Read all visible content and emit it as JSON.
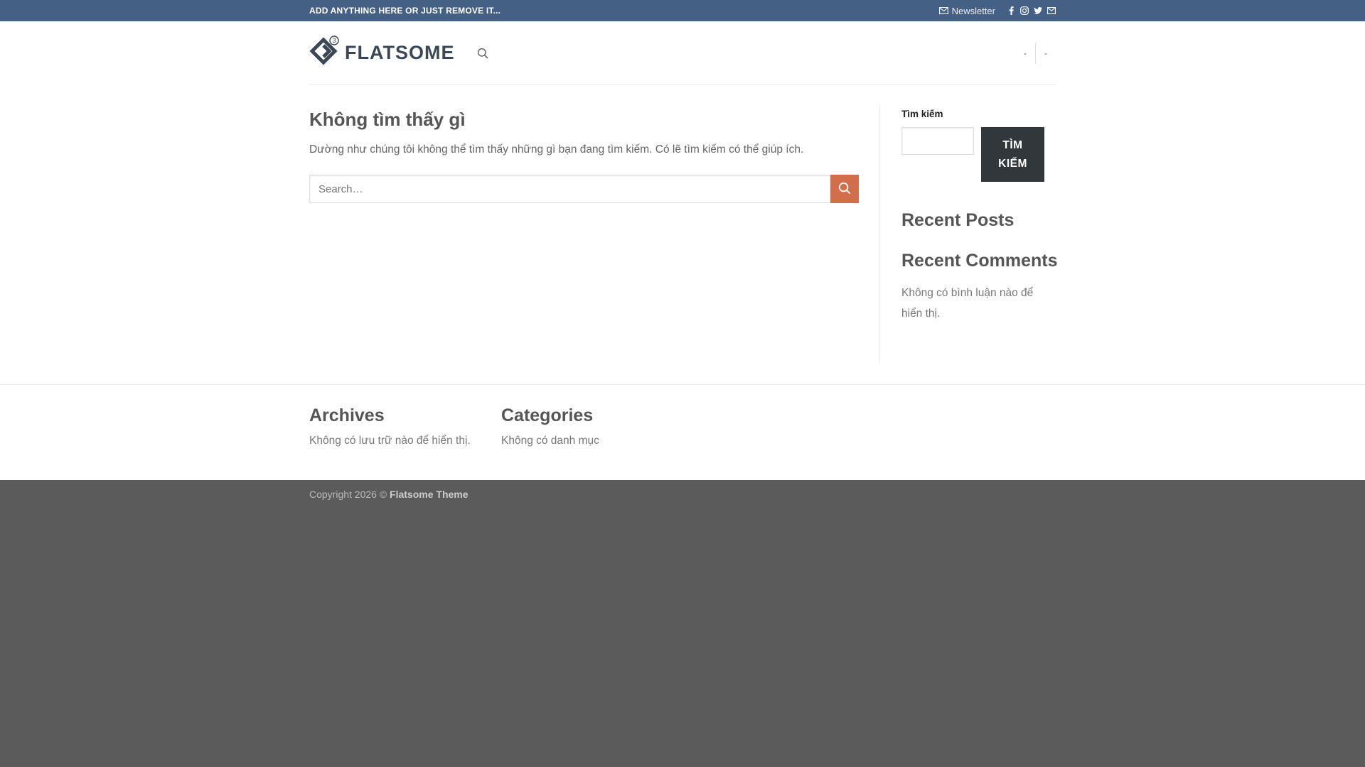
{
  "topbar": {
    "text": "ADD ANYTHING HERE OR JUST REMOVE IT...",
    "newsletter_label": "Newsletter",
    "social_icons": [
      "facebook-icon",
      "instagram-icon",
      "twitter-icon",
      "email-icon"
    ]
  },
  "header": {
    "logo_text": "FLATSOME",
    "logo_badge": "3",
    "right_links": [
      "-",
      "-"
    ]
  },
  "main": {
    "title": "Không tìm thấy gì",
    "description": "Dường như chúng tôi không thể tìm thấy những gì bạn đang tìm kiếm. Có lẽ tìm kiếm có thể giúp ích.",
    "search_placeholder": "Search…"
  },
  "sidebar": {
    "search_label": "Tìm kiếm",
    "search_button": "TÌM KIẾM",
    "recent_posts_title": "Recent Posts",
    "recent_comments_title": "Recent Comments",
    "recent_comments_empty": "Không có bình luận nào để hiển thị."
  },
  "footer": {
    "archives_title": "Archives",
    "archives_empty": "Không có lưu trữ nào để hiển thị.",
    "categories_title": "Categories",
    "categories_empty": "Không có danh mục",
    "copyright_prefix": "Copyright 2026 ©",
    "copyright_brand": "Flatsome Theme"
  },
  "colors": {
    "topbar": "#446084",
    "accent": "#d26e4b",
    "button_dark": "#32373c",
    "footer": "#5b5b5b"
  }
}
